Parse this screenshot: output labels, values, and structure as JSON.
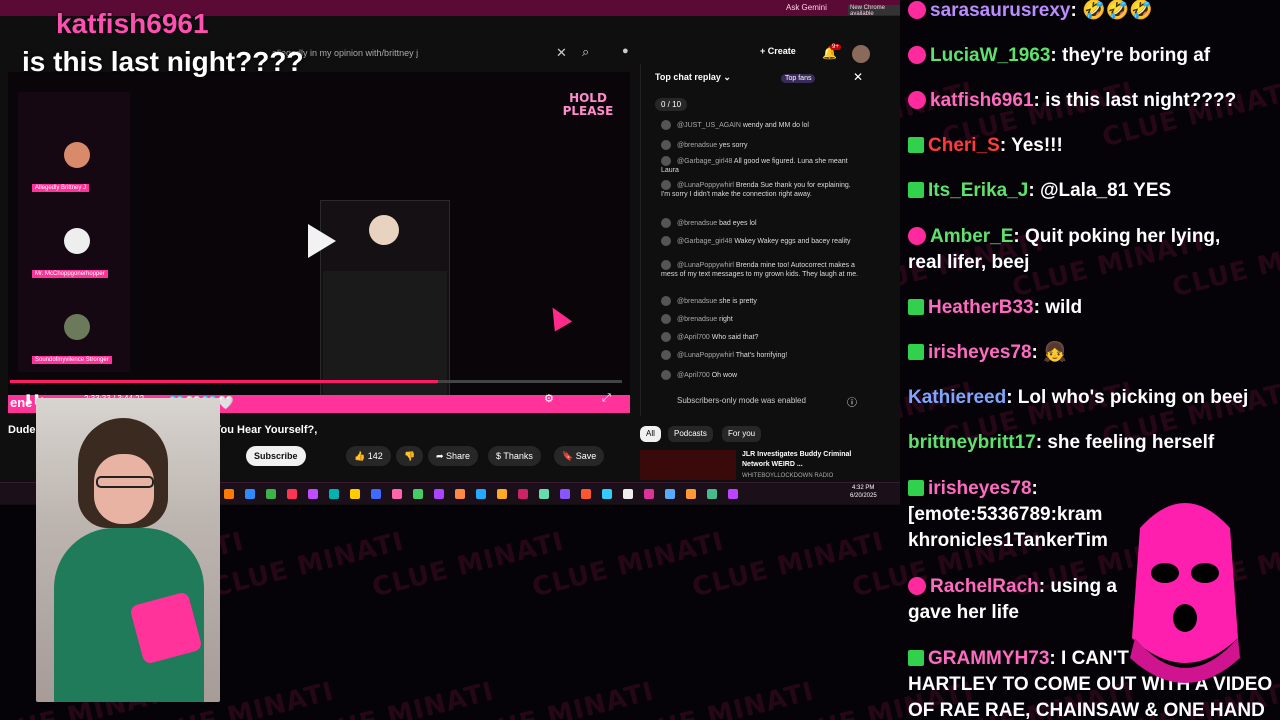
{
  "overlay": {
    "username": "katfish6961",
    "message": "is this last night????"
  },
  "browser": {
    "search_text": "allegedly in my opinion with/brittney j",
    "create_label": "Create",
    "notif_count": "9+",
    "ask_label": "Ask Gemini",
    "new_chrome": "New Chrome available"
  },
  "player": {
    "hold_text": "HOLD PLEASE",
    "time": "2:33:33 / 3:44:22",
    "ticker": "ene the momen... aware!! 🩵🤍🩵🤍",
    "side_names": [
      "Allegedly Brittney J",
      "Mr. McChoppgonerhopper",
      "Soundofmyvilence Stronger"
    ]
  },
  "below": {
    "title_left": "Dude",
    "title_right": "You Hear Yourself?,",
    "subscribe": "Subscribe",
    "likes": "142",
    "share": "Share",
    "thanks": "Thanks",
    "save": "Save"
  },
  "chat_replay": {
    "header": "Top chat replay",
    "top_fans": "Top fans",
    "count": "0 / 10",
    "messages": [
      {
        "name": "@JUST_US_AGAIN",
        "text": "wendy and MM do lol"
      },
      {
        "name": "@brenadsue",
        "text": "yes sorry"
      },
      {
        "name": "@Garbage_girl48",
        "text": "All good we figured. Luna she meant Laura"
      },
      {
        "name": "@LunaPoppywhirl",
        "text": "Brenda Sue thank you for explaining. I'm sorry I didn't make the connection right away."
      },
      {
        "name": "@brenadsue",
        "text": "bad eyes lol"
      },
      {
        "name": "@Garbage_girl48",
        "text": "Wakey Wakey eggs and bacey reality"
      },
      {
        "name": "@LunaPoppywhirl",
        "text": "Brenda mine too! Autocorrect makes a mess of my text messages to my grown kids. They laugh at me."
      },
      {
        "name": "@brenadsue",
        "text": "she is pretty"
      },
      {
        "name": "@brenadsue",
        "text": "right"
      },
      {
        "name": "@April700",
        "text": "Who said that?"
      },
      {
        "name": "@LunaPoppywhirl",
        "text": "That's horrifying!"
      },
      {
        "name": "@April700",
        "text": "Oh wow"
      }
    ],
    "subs_only": "Subscribers-only mode was enabled"
  },
  "filters": [
    "All",
    "Podcasts",
    "For you"
  ],
  "rec": {
    "title": "JLR Investigates Buddy Criminal Network WEIRD ...",
    "channel": "WHITEBOYLLOCKDOWN RADIO"
  },
  "clock": {
    "time": "4:32 PM",
    "date": "6/20/2025"
  },
  "watermark": "CLUE MINATI",
  "stream_chat": [
    {
      "user": "sarasaurusrexy",
      "color": "#b98cff",
      "text": ": 🤣🤣🤣"
    },
    {
      "user": "LuciaW_1963",
      "color": "#5ee16d",
      "text": ": they're boring af"
    },
    {
      "user": "katfish6961",
      "color": "#ff6bc1",
      "text": ": is this last night????"
    },
    {
      "user": "Cheri_S",
      "color": "#ff3b3b",
      "text": ": Yes!!!"
    },
    {
      "user": "Its_Erika_J",
      "color": "#5ee16d",
      "text": ": @Lala_81 YES"
    },
    {
      "user": "Amber_E",
      "color": "#5ee16d",
      "text": ": Quit poking her lying,"
    },
    {
      "user": "",
      "color": "#fff",
      "text": "real lifer, beej"
    },
    {
      "user": "HeatherB33",
      "color": "#ff6bc1",
      "text": ": wild"
    },
    {
      "user": "irisheyes78",
      "color": "#ff6bc1",
      "text": ": 👧"
    },
    {
      "user": "Kathiereed",
      "color": "#7ea6ff",
      "text": ": Lol who's picking on beej"
    },
    {
      "user": "brittneybritt17",
      "color": "#5ee16d",
      "text": ": she feeling herself"
    },
    {
      "user": "irisheyes78",
      "color": "#ff6bc1",
      "text": ":"
    },
    {
      "user": "",
      "color": "#fff",
      "text": "[emote:5336789:kram"
    },
    {
      "user": "",
      "color": "#fff",
      "text": "khronicles1TankerTim"
    },
    {
      "user": "RachelRach",
      "color": "#ff6bc1",
      "text": ": using a"
    },
    {
      "user": "",
      "color": "#fff",
      "text": "gave her life"
    },
    {
      "user": "GRAMMYH73",
      "color": "#ff6bc1",
      "text": ": I CAN'T"
    },
    {
      "user": "",
      "color": "#fff",
      "text": "HARTLEY TO COME OUT WITH A VIDEO"
    },
    {
      "user": "",
      "color": "#fff",
      "text": "OF RAE RAE, CHAINSAW & ONE HAND"
    }
  ]
}
